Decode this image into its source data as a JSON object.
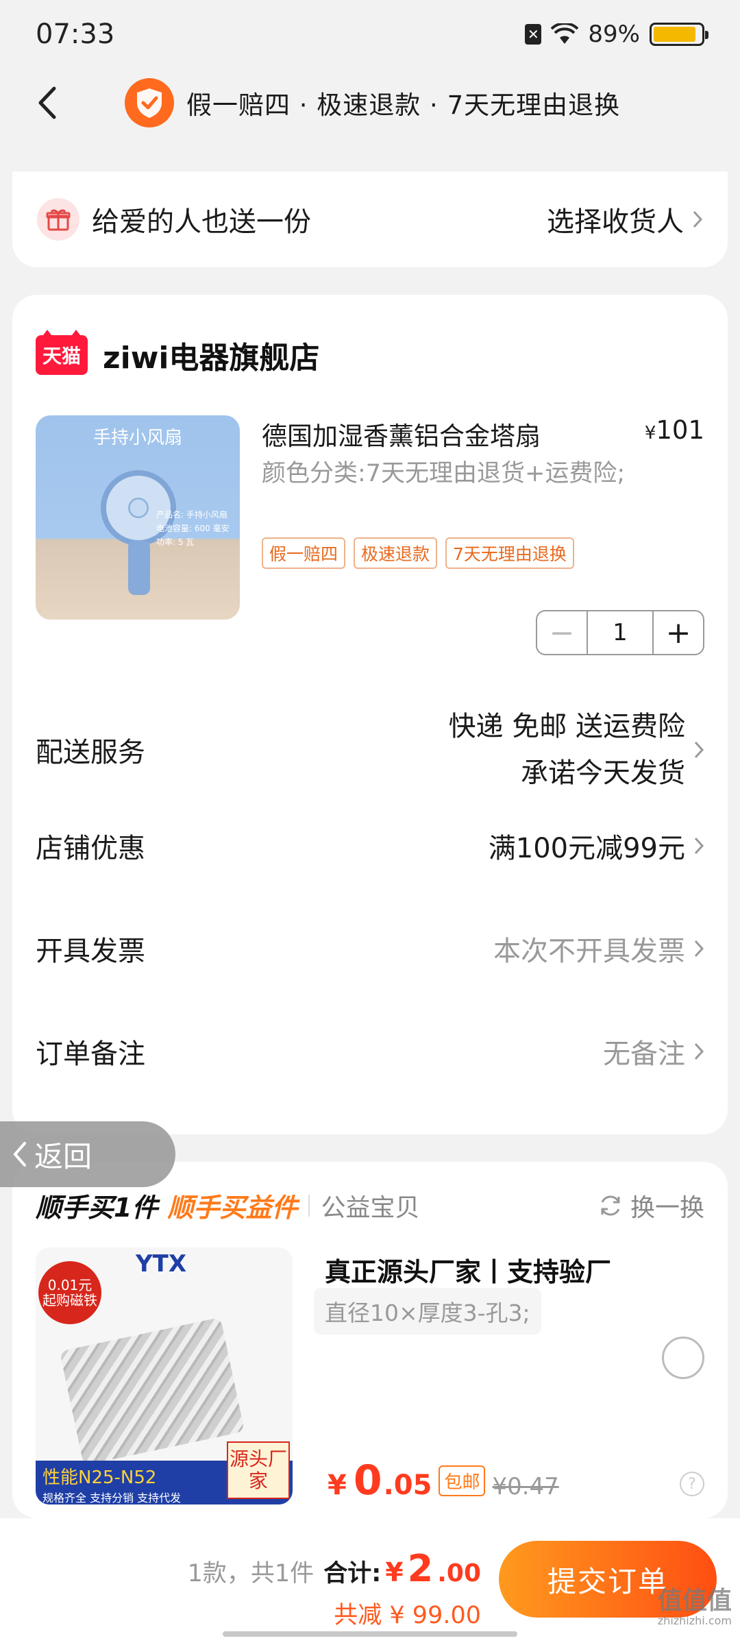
{
  "status_bar": {
    "time": "07:33",
    "battery": "89%",
    "battery_level": 0.89,
    "sim_icon": "✕"
  },
  "header": {
    "guarantee_text": "假一赔四 · 极速退款 · 7天无理由退换"
  },
  "gift": {
    "label": "给爱的人也送一份",
    "action": "选择收货人"
  },
  "store": {
    "logo_text": "天猫",
    "name": "ziwi电器旗舰店"
  },
  "product": {
    "image_caption": "手持小风扇",
    "image_specs": [
      "产品名: 手持小风扇",
      "电池容量: 600 毫安",
      "功率: 5 瓦"
    ],
    "title": "德国加湿香薰铝合金塔扇",
    "price_symbol": "¥",
    "price": "101",
    "sku": "颜色分类:7天无理由退货+运费险;",
    "tags": [
      "假一赔四",
      "极速退款",
      "7天无理由退换"
    ],
    "quantity": "1",
    "minus": "−",
    "plus": "+"
  },
  "rows": {
    "delivery": {
      "label": "配送服务",
      "line1": "快递 免邮 送运费险",
      "line2": "承诺今天发货"
    },
    "coupon": {
      "label": "店铺优惠",
      "value": "满100元减99元"
    },
    "invoice": {
      "label": "开具发票",
      "value": "本次不开具发票"
    },
    "remark": {
      "label": "订单备注",
      "value": "无备注"
    }
  },
  "return_button": {
    "label": "返回"
  },
  "extra": {
    "title1": "顺手买1件",
    "title2": "顺手买益件",
    "title3": "公益宝贝",
    "swap": "换一换",
    "image": {
      "brand": "YTX",
      "badge_price": "0.01元",
      "badge_sub": "起购磁铁",
      "banner": "性能N25-N52",
      "banner_sub": "规格齐全 支持分销 支持代发",
      "origin": "源头厂家"
    },
    "name": "真正源头厂家丨支持验厂",
    "spec": "直径10×厚度3-孔3;",
    "price_symbol": "¥",
    "price_int": "0",
    "price_dec": ".05",
    "ship_tag": "包邮",
    "orig_price": "¥0.47",
    "help": "?"
  },
  "bottom": {
    "count": "1款，共1件",
    "total_label": "合计:",
    "total_symbol": "¥",
    "total_int": "2",
    "total_dec": ".00",
    "discount": "共减 ¥ 99.00",
    "submit": "提交订单"
  },
  "watermark": {
    "text": "值值值",
    "url": "zhizhizhi.com"
  },
  "colors": {
    "accent": "#ff5a1f",
    "price_red": "#ff3b1f",
    "tmall_red": "#ff1a3c",
    "bg": "#f2f2f2"
  }
}
